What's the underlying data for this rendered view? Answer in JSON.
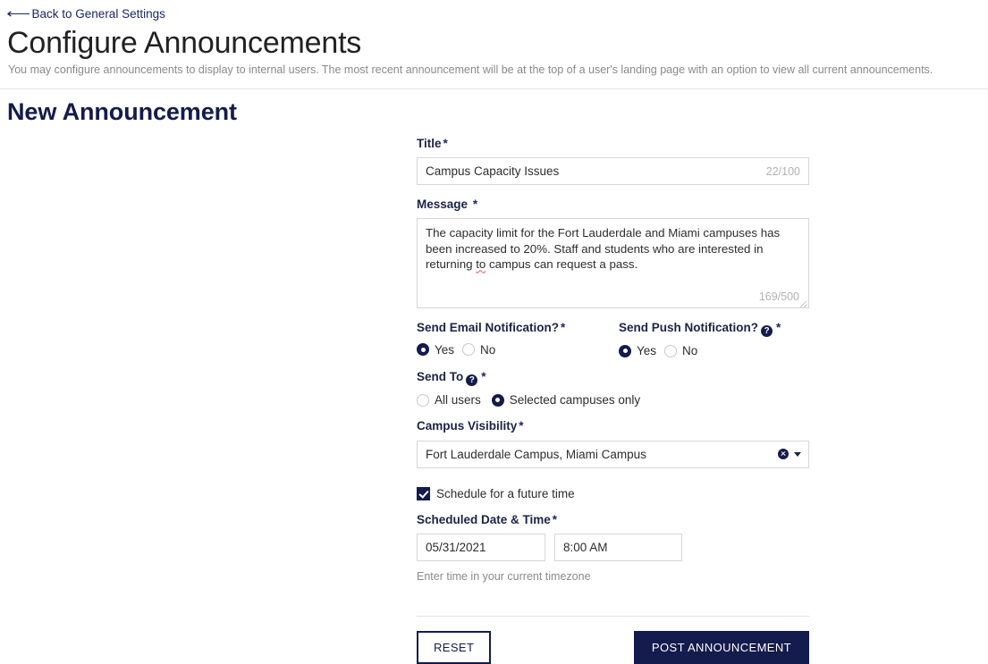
{
  "header": {
    "back_link": "Back to General Settings",
    "back_arrow_icon": "arrow-left-long",
    "title": "Configure Announcements",
    "subtitle": "You may configure announcements to display to internal users. The most recent announcement will be at the top of a user's landing page with an option to view all current announcements.",
    "section_title": "New Announcement"
  },
  "colors": {
    "navy": "#141b4d",
    "link": "#1b2664",
    "border": "#d6d6d6",
    "muted": "#8a8a8a",
    "counter": "#b2b2b2"
  },
  "form": {
    "title_field": {
      "label": "Title",
      "required_mark": "*",
      "value": "Campus Capacity Issues",
      "placeholder": "",
      "counter": "22/100"
    },
    "message_field": {
      "label": "Message",
      "required_mark": "*",
      "value": "The capacity limit for the Fort Lauderdale and Miami campuses has been increased to 20%. Staff and students who are interested in returning to campus can request a pass.",
      "line1": "The capacity limit for the Fort Lauderdale and Miami campuses has",
      "line2a": "been increased to 20%. Staff and students who are interested in",
      "line3a": "returning ",
      "line3b": "to",
      "line3c": " campus can request a pass.",
      "placeholder": "",
      "counter": "169/500"
    },
    "email_notification": {
      "label": "Send Email Notification?",
      "required_mark": "*",
      "options": [
        "Yes",
        "No"
      ],
      "selected": "Yes"
    },
    "push_notification": {
      "label": "Send Push Notification?",
      "required_mark": "*",
      "help_icon": "question-mark-icon",
      "help_glyph": "?",
      "options": [
        "Yes",
        "No"
      ],
      "selected": "Yes"
    },
    "send_to": {
      "label": "Send To",
      "required_mark": "*",
      "help_icon": "question-mark-icon",
      "help_glyph": "?",
      "options": [
        "All users",
        "Selected campuses only"
      ],
      "selected": "Selected campuses only"
    },
    "campus_visibility": {
      "label": "Campus Visibility",
      "required_mark": "*",
      "value": "Fort Lauderdale Campus, Miami Campus",
      "selected_options": [
        "Fort Lauderdale Campus",
        "Miami Campus"
      ],
      "clear_icon": "clear-circle-x-icon",
      "dropdown_icon": "chevron-down-icon"
    },
    "schedule_checkbox": {
      "label": "Schedule for a future time",
      "checked": true
    },
    "scheduled_datetime": {
      "label": "Scheduled Date & Time",
      "required_mark": "*",
      "date_value": "05/31/2021",
      "time_value": "8:00 AM",
      "hint": "Enter time in your current timezone"
    }
  },
  "actions": {
    "reset_label": "RESET",
    "post_label": "POST ANNOUNCEMENT"
  }
}
